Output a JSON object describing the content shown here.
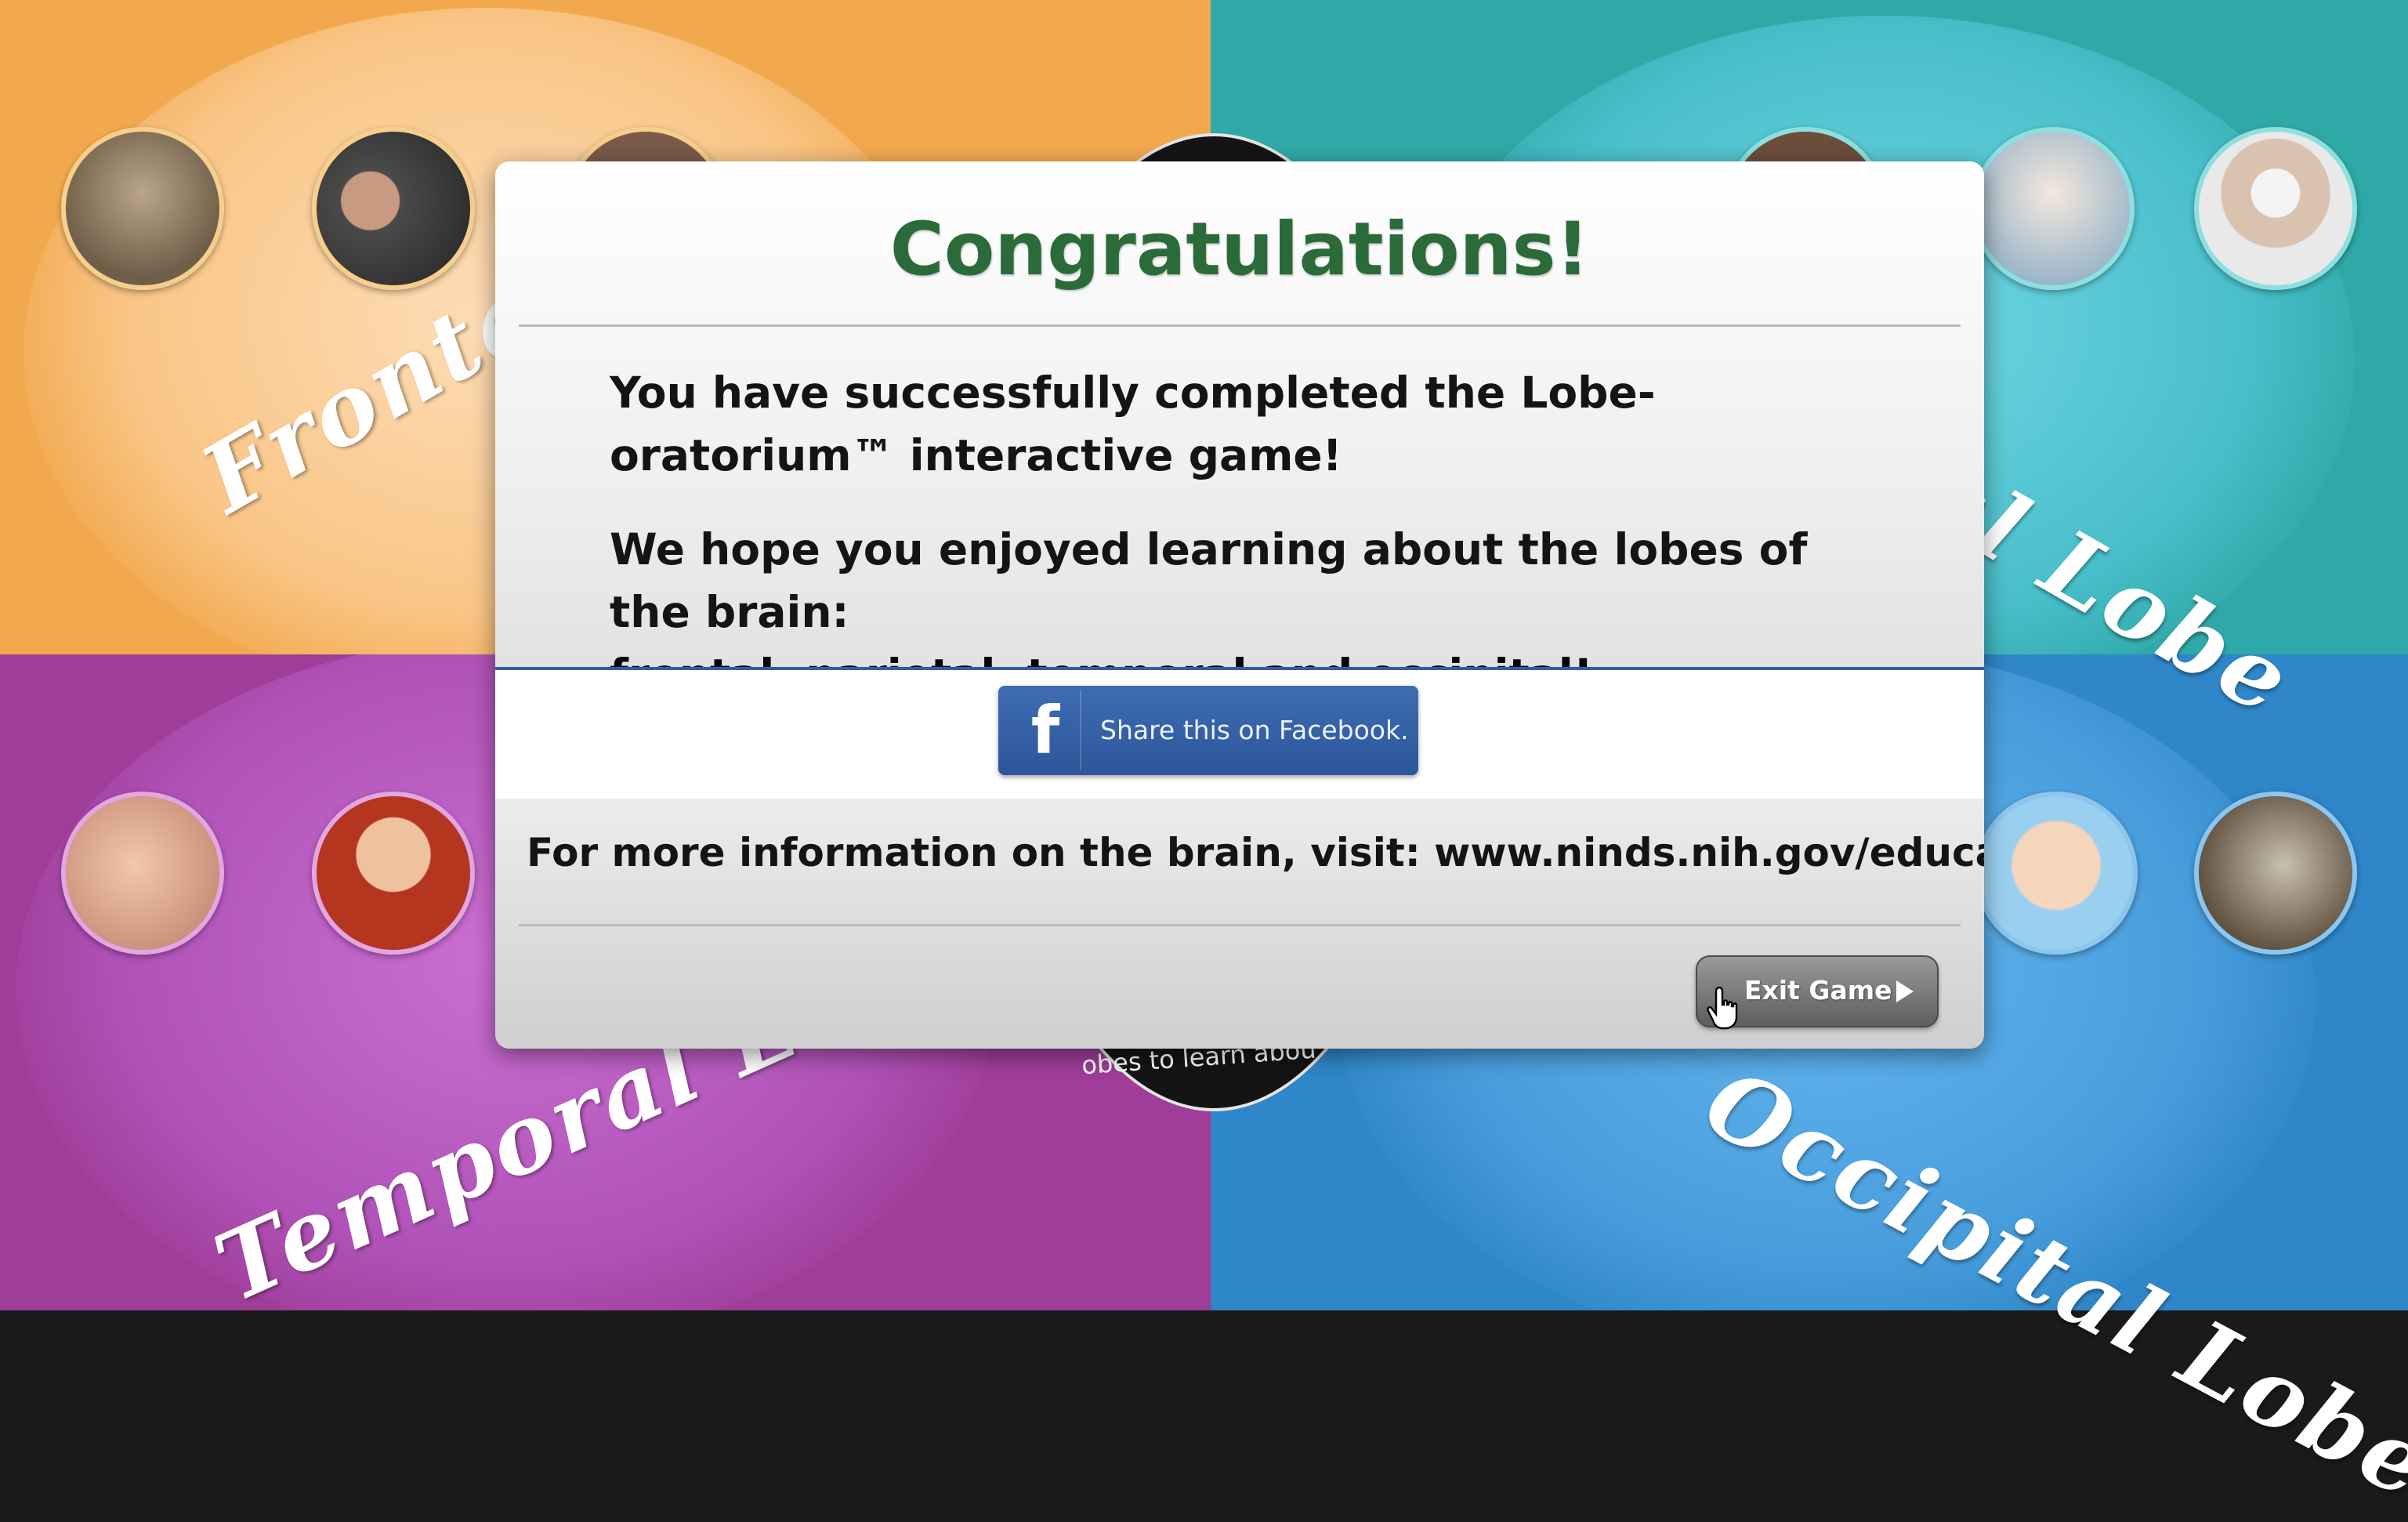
{
  "background": {
    "quadrants": {
      "frontal": {
        "label": "Frontal",
        "color": "#f2a94e"
      },
      "parietal": {
        "label": "al Lobe",
        "color": "#2fa9a8"
      },
      "temporal": {
        "label": "Temporal Lobe",
        "color": "#9f3d98"
      },
      "occipital": {
        "label": "Occipital Lobe",
        "color": "#2f86c8"
      }
    },
    "disc_text": "obes to learn abou"
  },
  "modal": {
    "title": "Congratulations!",
    "paragraph1": "You have successfully completed the Lobe-oratorium™ interactive game!",
    "paragraph2_lead": "We hope you enjoyed learning about the lobes of the brain:",
    "paragraph2_bold": "frontal, parietal, temporal and occipital!",
    "share_button": {
      "icon": "facebook-icon",
      "label": "Share this on Facebook."
    },
    "info_text": "For more information on the brain, visit: www.ninds.nih.gov/education",
    "exit_button": {
      "label": "Exit Game",
      "icon": "play-arrow-icon"
    }
  },
  "colors": {
    "title_green": "#2b6b3a",
    "facebook_blue": "#2d5fa3"
  }
}
